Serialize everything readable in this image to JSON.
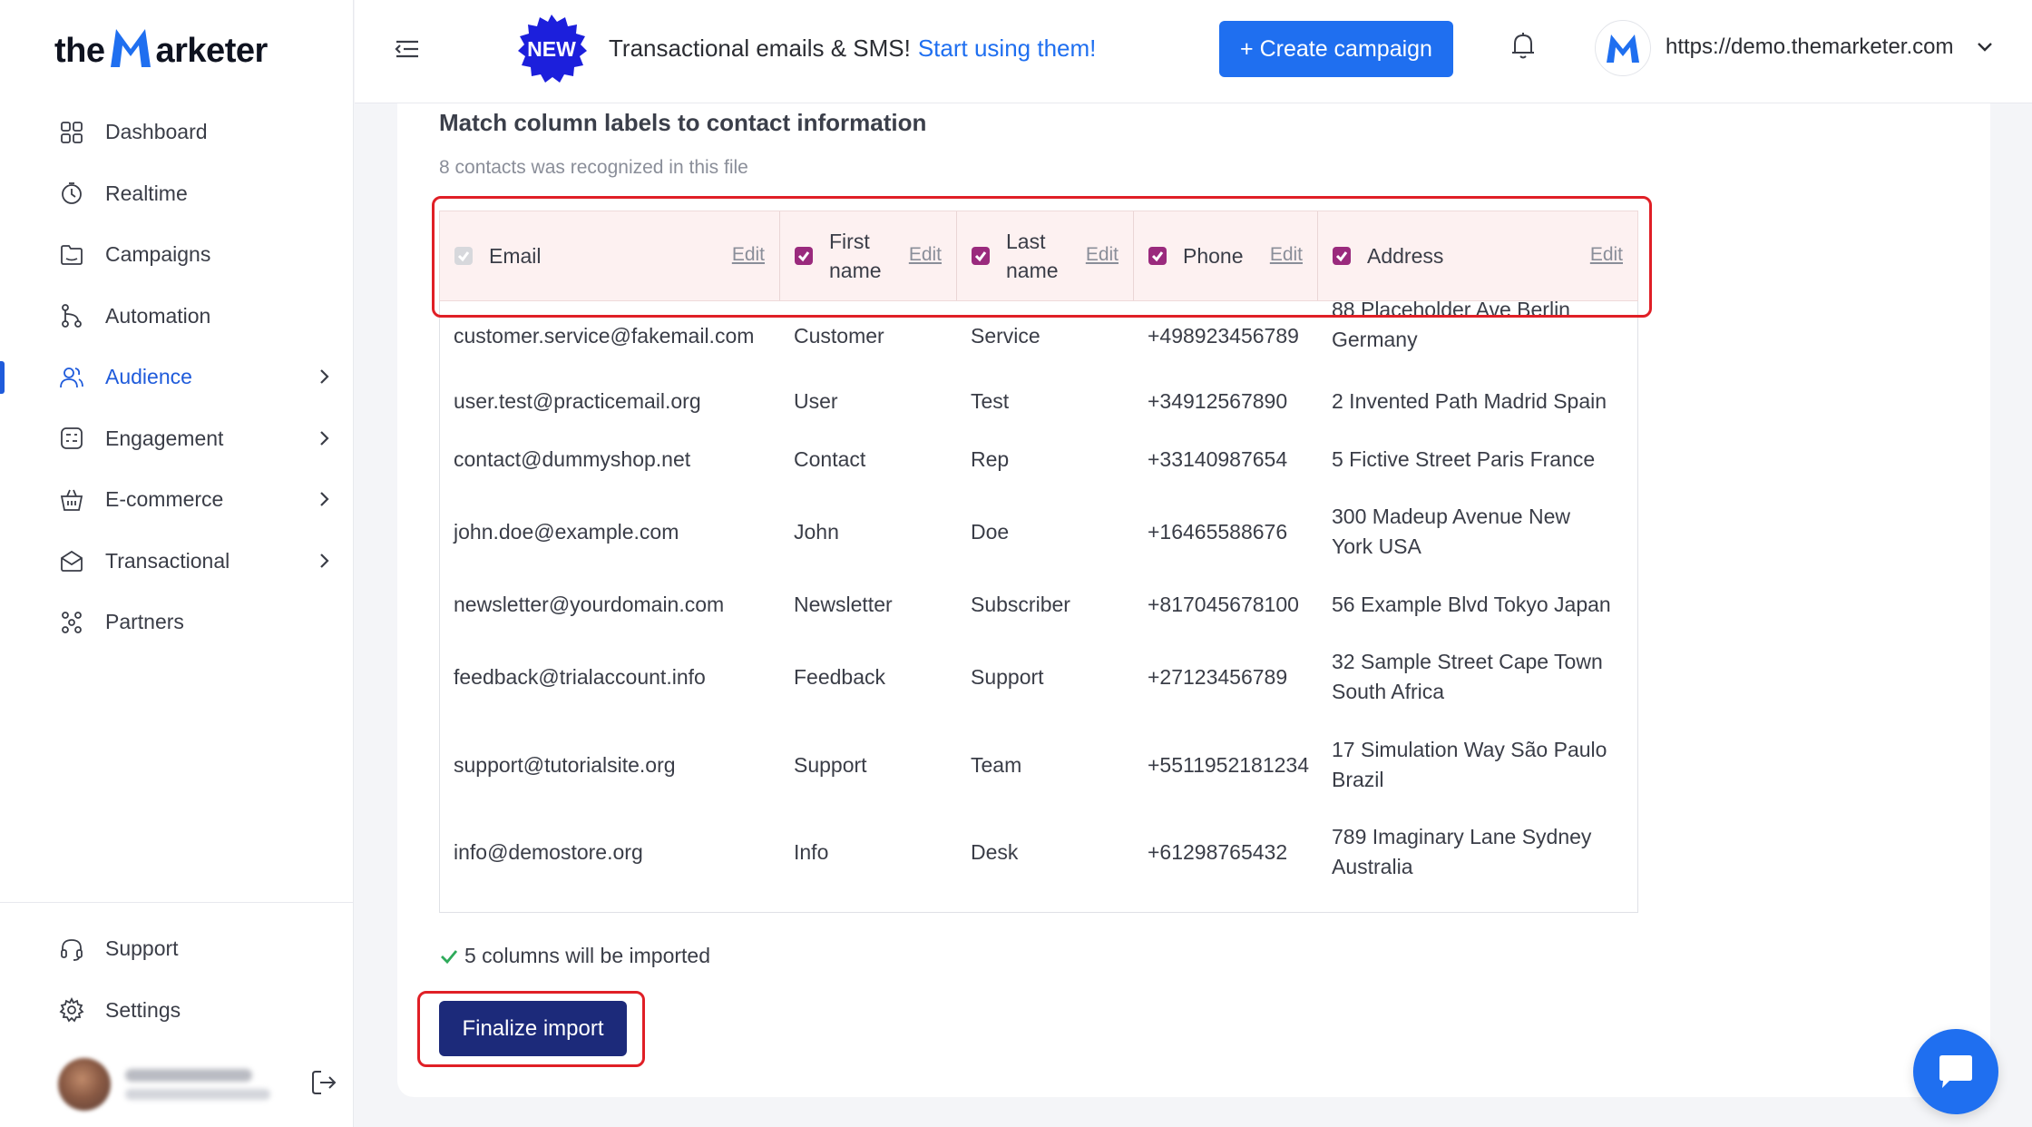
{
  "brand": {
    "logo_left": "the",
    "logo_right": "arketer",
    "accent": "#1f6ff0",
    "active_nav": "#1f5bdb"
  },
  "sidebar": {
    "items": [
      {
        "label": "Dashboard",
        "icon": "dashboard-icon"
      },
      {
        "label": "Realtime",
        "icon": "realtime-icon"
      },
      {
        "label": "Campaigns",
        "icon": "campaigns-icon"
      },
      {
        "label": "Automation",
        "icon": "automation-icon"
      },
      {
        "label": "Audience",
        "icon": "audience-icon",
        "active": true,
        "has_submenu": true
      },
      {
        "label": "Engagement",
        "icon": "engagement-icon",
        "has_submenu": true
      },
      {
        "label": "E-commerce",
        "icon": "ecommerce-icon",
        "has_submenu": true
      },
      {
        "label": "Transactional",
        "icon": "transactional-icon",
        "has_submenu": true
      },
      {
        "label": "Partners",
        "icon": "partners-icon"
      }
    ],
    "bottom_items": [
      {
        "label": "Support",
        "icon": "support-icon"
      },
      {
        "label": "Settings",
        "icon": "settings-icon"
      }
    ]
  },
  "header": {
    "badge": "NEW",
    "promo_text": "Transactional emails & SMS!",
    "promo_link": "Start using them!",
    "create_button": "+ Create campaign",
    "account_url": "https://demo.themarketer.com"
  },
  "import": {
    "title": "Match column labels to contact information",
    "subtitle": "8 contacts was recognized in this file",
    "edit_label": "Edit",
    "columns": [
      {
        "label": "Email",
        "checked": true,
        "disabled": true
      },
      {
        "label": "First name",
        "checked": true
      },
      {
        "label": "Last name",
        "checked": true
      },
      {
        "label": "Phone",
        "checked": true
      },
      {
        "label": "Address",
        "checked": true
      }
    ],
    "rows": [
      [
        "customer.service@fakemail.com",
        "Customer",
        "Service",
        "+498923456789",
        "88 Placeholder Ave Berlin Germany"
      ],
      [
        "user.test@practicemail.org",
        "User",
        "Test",
        "+34912567890",
        "2 Invented Path Madrid Spain"
      ],
      [
        "contact@dummyshop.net",
        "Contact",
        "Rep",
        "+33140987654",
        "5 Fictive Street Paris France"
      ],
      [
        "john.doe@example.com",
        "John",
        "Doe",
        "+16465588676",
        "300 Madeup Avenue New York USA"
      ],
      [
        "newsletter@yourdomain.com",
        "Newsletter",
        "Subscriber",
        "+817045678100",
        "56 Example Blvd Tokyo Japan"
      ],
      [
        "feedback@trialaccount.info",
        "Feedback",
        "Support",
        "+27123456789",
        "32 Sample Street Cape Town South Africa"
      ],
      [
        "support@tutorialsite.org",
        "Support",
        "Team",
        "+5511952181234",
        "17 Simulation Way São Paulo Brazil"
      ],
      [
        "info@demostore.org",
        "Info",
        "Desk",
        "+61298765432",
        "789 Imaginary Lane Sydney Australia"
      ]
    ],
    "columns_imported": "5 columns will be imported",
    "finalize_button": "Finalize import"
  }
}
